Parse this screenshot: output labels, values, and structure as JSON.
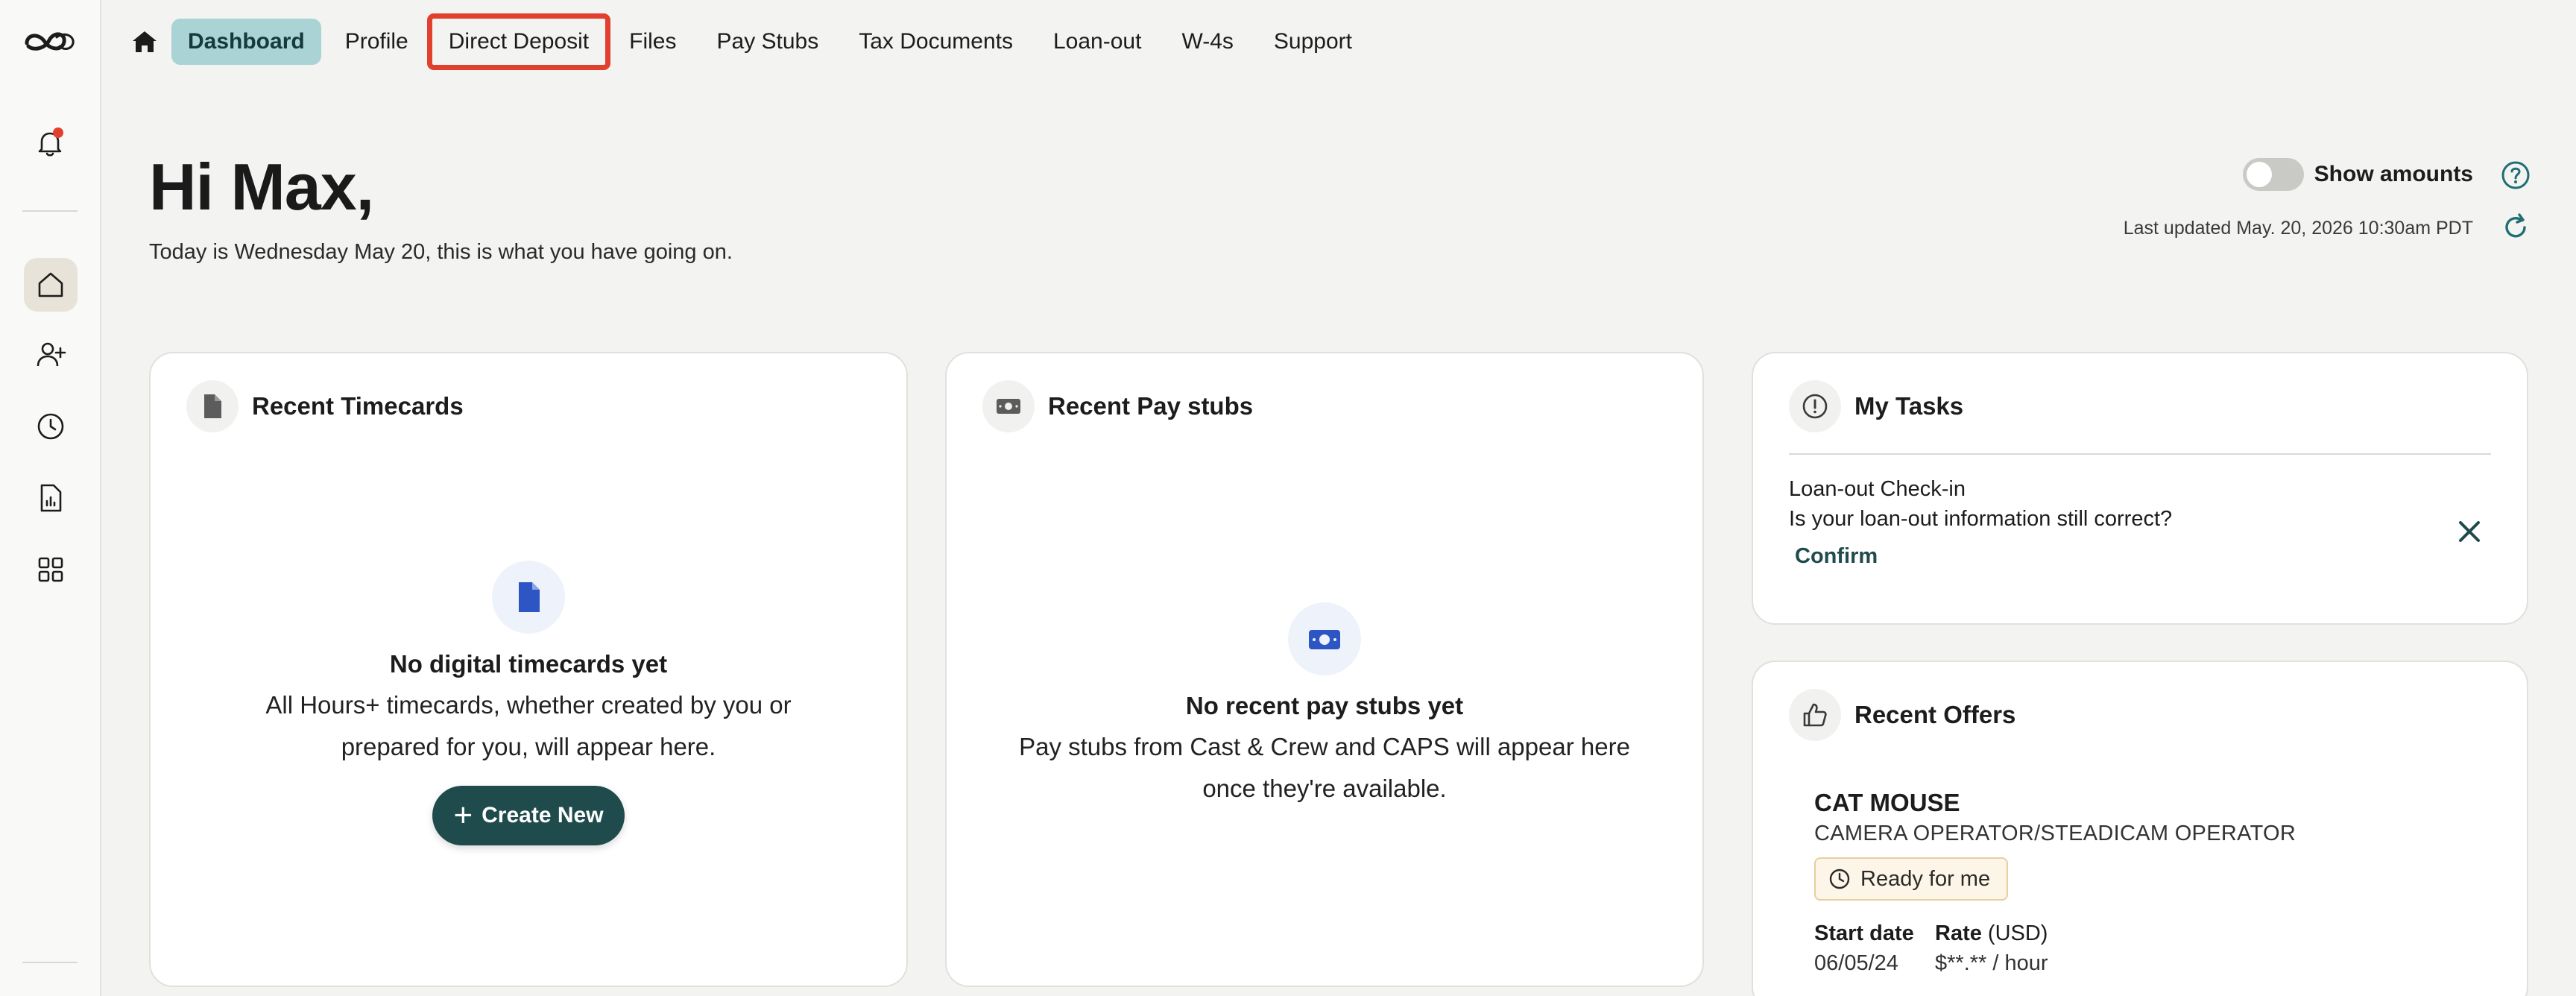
{
  "nav": {
    "tabs": [
      {
        "label": "Dashboard"
      },
      {
        "label": "Profile"
      },
      {
        "label": "Direct Deposit"
      },
      {
        "label": "Files"
      },
      {
        "label": "Pay Stubs"
      },
      {
        "label": "Tax Documents"
      },
      {
        "label": "Loan-out"
      },
      {
        "label": "W-4s"
      },
      {
        "label": "Support"
      }
    ],
    "active_tab": "Dashboard",
    "highlighted_tab": "Direct Deposit"
  },
  "header": {
    "greeting": "Hi Max,",
    "subline": "Today is Wednesday May 20, this is what you have going on.",
    "show_amounts_label": "Show amounts",
    "last_updated": "Last updated May. 20, 2026 10:30am PDT"
  },
  "timecards": {
    "title": "Recent Timecards",
    "empty_title": "No digital timecards yet",
    "empty_desc": "All Hours+ timecards, whether created by you or prepared for you, will appear here.",
    "create_label": "Create New"
  },
  "paystubs": {
    "title": "Recent Pay stubs",
    "empty_title": "No recent pay stubs yet",
    "empty_desc": "Pay stubs from Cast & Crew and CAPS will appear here once they're available."
  },
  "tasks": {
    "title": "My Tasks",
    "item_title": "Loan-out Check-in",
    "item_desc": "Is your loan-out information still correct?",
    "confirm_label": "Confirm"
  },
  "offers": {
    "title": "Recent Offers",
    "name": "CAT MOUSE",
    "role": "CAMERA OPERATOR/STEADICAM OPERATOR",
    "status": "Ready for me",
    "start_label": "Start date",
    "rate_label": "Rate",
    "rate_unit": "(USD)",
    "start_value": "06/05/24",
    "rate_value": "$**.** / hour"
  },
  "colors": {
    "accent": "#1f4b4c",
    "active_tab_bg": "#a9d3d5",
    "highlight": "#e1402f",
    "notification": "#e1402f"
  },
  "icons": {
    "rail": [
      "logo-icon",
      "bell-icon",
      "home-icon",
      "add-user-icon",
      "clock-icon",
      "document-chart-icon",
      "grid-icon"
    ]
  }
}
